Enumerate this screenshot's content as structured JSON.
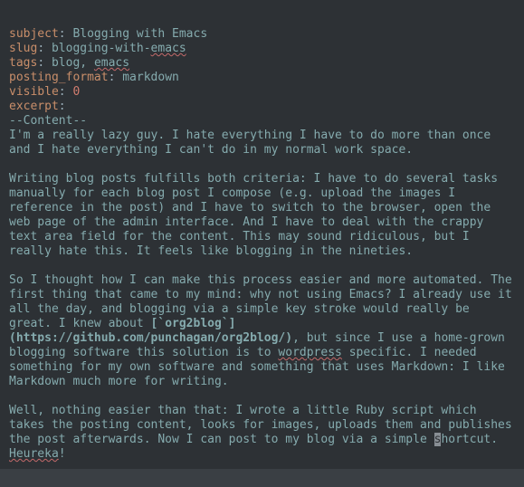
{
  "front_matter": {
    "subject_key": "subject",
    "subject_val": "Blogging with Emacs",
    "slug_key": "slug",
    "slug_val_pre": "blogging-with-",
    "slug_val_spell": "emacs",
    "tags_key": "tags",
    "tags_val_pre": "blog, ",
    "tags_val_spell": "emacs",
    "pf_key": "posting_format",
    "pf_val": "markdown",
    "visible_key": "visible",
    "visible_val": "0",
    "excerpt_key": "excerpt",
    "content_marker": "--Content--"
  },
  "body": {
    "p1": "I'm a really lazy guy. I hate everything I have to do more than once and I hate everything I can't do in my normal work space.",
    "p2": "Writing blog posts fulfills both criteria: I have to do several tasks manually for each blog post I compose (e.g. upload the images I reference in the post) and I have to switch to the browser, open the web page of the admin interface. And I have to deal with the crappy text area field for the content. This may sound ridiculous, but I really hate this. It feels like blogging in the nineties.",
    "p3": "So I thought how I can make this process easier and more automated. The first thing that came to my mind: why not using Emacs? I already use it all the day, and blogging via a simple key stroke would really be great. I knew about ",
    "link_label": "[`org2blog`]",
    "link_url": "(https://github.com/punchagan/org2blog/)",
    "p3b_a": ", but since I use a home-grown blogging software this solution is to ",
    "p3b_spell": "wordpress",
    "p3b_b": " specific. I needed something for my own software and something that uses Markdown: I like Markdown much more for writing.",
    "p4a": "Well, nothing easier than that: I wrote a little Ruby script which takes the posting content, looks for images, uploads them and publishes the post afterwards. Now I can post to my blog via a simple ",
    "p4_cursor": "s",
    "p4b_a": "hortcut. ",
    "p4b_spell": "Heureka",
    "p4b_b": "!"
  },
  "colon": ":",
  "space": " "
}
